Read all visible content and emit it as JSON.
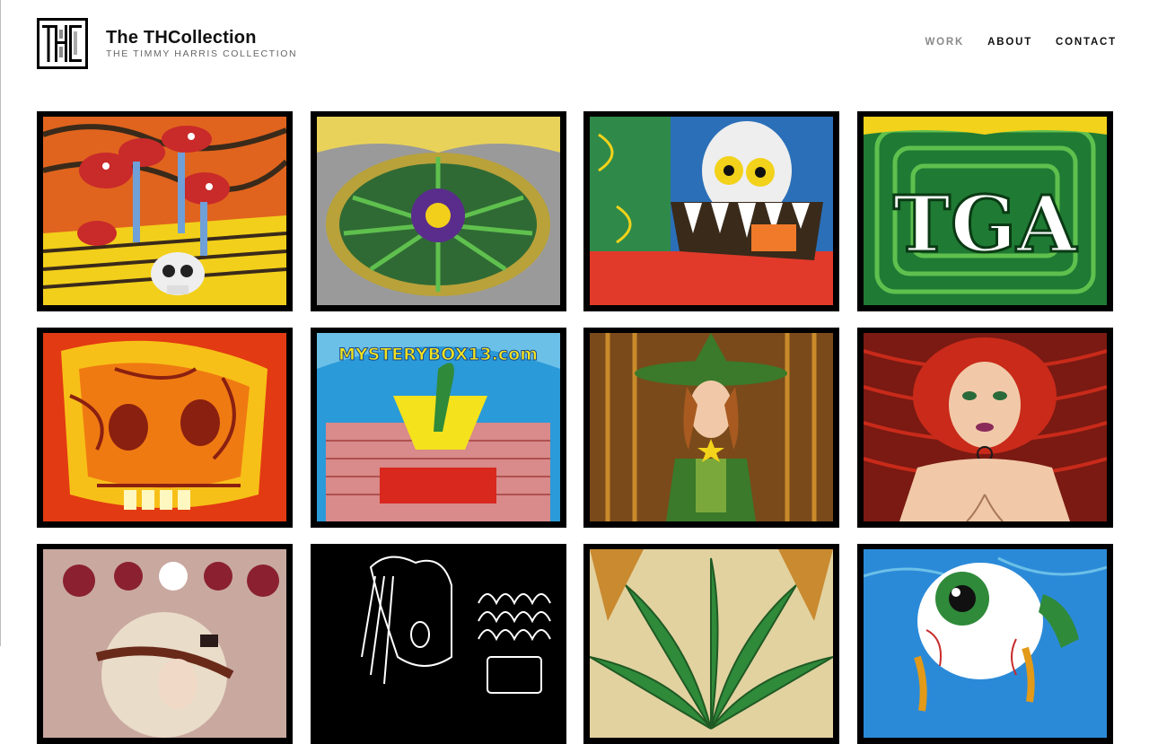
{
  "site": {
    "title": "The THCollection",
    "subtitle": "THE TIMMY HARRIS COLLECTION",
    "logo_text": "THC"
  },
  "nav": {
    "items": [
      {
        "label": "WORK",
        "active": true
      },
      {
        "label": "ABOUT",
        "active": false
      },
      {
        "label": "CONTACT",
        "active": false
      }
    ]
  },
  "gallery": {
    "artworks": [
      {
        "subject": "mushrooms-skull",
        "palette": [
          "#e0641e",
          "#2b6fb8",
          "#f2cf1a",
          "#c92a2a"
        ]
      },
      {
        "subject": "cannabis-mandala",
        "palette": [
          "#2f8a3a",
          "#d9d92a",
          "#5a2d8c",
          "#9a9a9a"
        ]
      },
      {
        "subject": "green-monster",
        "palette": [
          "#2f8a4a",
          "#e23a2a",
          "#f2d21a",
          "#2b6fb8"
        ]
      },
      {
        "subject": "tga-lettering",
        "palette": [
          "#1f7a34",
          "#5fc04e",
          "#ffffff",
          "#ffe36a"
        ],
        "text": "TGA"
      },
      {
        "subject": "fire-skull",
        "palette": [
          "#f07a12",
          "#f7c018",
          "#e23a12",
          "#8a2010"
        ]
      },
      {
        "subject": "mystery-box",
        "palette": [
          "#2b9ad8",
          "#f4e21c",
          "#d9281e",
          "#6bc0e8"
        ],
        "text": "MYSTERYBOX13.com"
      },
      {
        "subject": "witch",
        "palette": [
          "#3a7a2a",
          "#c98a2a",
          "#7a4a1a",
          "#f4d41a"
        ]
      },
      {
        "subject": "red-haired-woman",
        "palette": [
          "#c92a1a",
          "#7a1a12",
          "#f1c9a8",
          "#1a1a1a"
        ]
      },
      {
        "subject": "pinball-woman",
        "palette": [
          "#c9a8a0",
          "#8a2030",
          "#ffffff",
          "#2a1a1a"
        ]
      },
      {
        "subject": "screaming-man",
        "palette": [
          "#000000",
          "#ffffff",
          "#d8d8d8",
          "#555555"
        ]
      },
      {
        "subject": "cannabis-leaf",
        "palette": [
          "#2f8a3a",
          "#c98a30",
          "#1f5a24",
          "#e2d2a0"
        ]
      },
      {
        "subject": "eyeball",
        "palette": [
          "#2b8ad8",
          "#ffffff",
          "#2f8a3a",
          "#e29a18"
        ]
      }
    ]
  }
}
